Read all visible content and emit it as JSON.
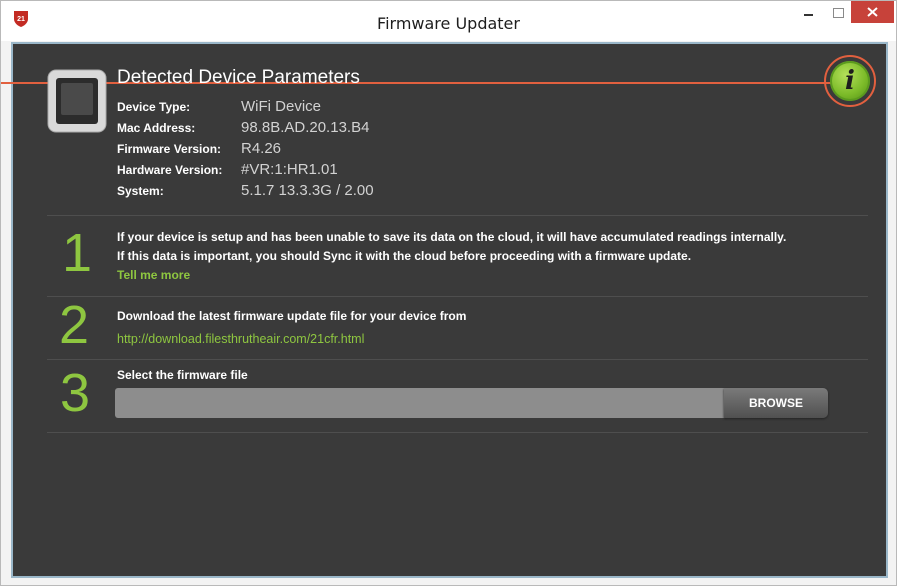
{
  "window": {
    "title": "Firmware Updater",
    "colors": {
      "accent": "#8ec640",
      "close": "#c7423a",
      "callout": "#e2603f",
      "panel": "#3a3a3a"
    }
  },
  "device": {
    "section_title": "Detected Device Parameters",
    "params": [
      {
        "label": "Device Type:",
        "value": "WiFi Device"
      },
      {
        "label": "Mac Address:",
        "value": "98.8B.AD.20.13.B4"
      },
      {
        "label": "Firmware Version:",
        "value": "R4.26"
      },
      {
        "label": "Hardware Version:",
        "value": "#VR:1:HR1.01"
      },
      {
        "label": "System:",
        "value": "5.1.7 13.3.3G / 2.00"
      }
    ]
  },
  "steps": [
    {
      "number": "1",
      "line1": "If your device is setup and has been unable to save its data on the cloud, it will have accumulated readings internally.",
      "line2": "If this data is important, you should Sync it with the cloud before proceeding with a firmware update.",
      "link": "Tell me more"
    },
    {
      "number": "2",
      "line1": "Download the latest firmware update file for your device from",
      "link": "http://download.filesthrutheair.com/21cfr.html"
    },
    {
      "number": "3",
      "line1": "Select the firmware file",
      "file_value": "",
      "browse_label": "BROWSE"
    }
  ],
  "icons": {
    "app": "app-shield-icon",
    "info": "info-icon",
    "device": "device-icon"
  },
  "info_glyph": "i"
}
